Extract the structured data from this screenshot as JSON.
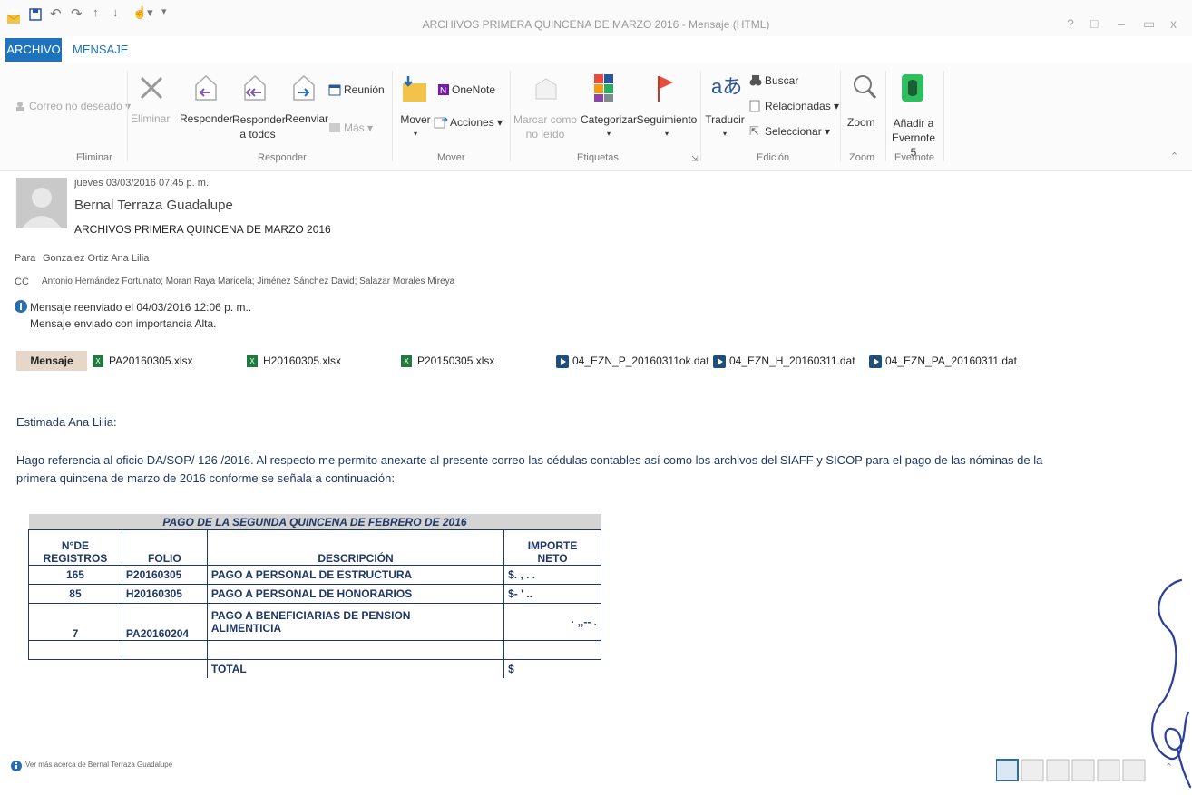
{
  "titlebar": {
    "title": "ARCHIVOS PRIMERA QUINCENA DE MARZO 2016 - Mensaje (HTML)",
    "controls": [
      "?",
      "□",
      "–",
      "▭",
      "x"
    ]
  },
  "tabs": {
    "archivo": "ARCHIVO",
    "mensaje": "MENSAJE"
  },
  "ribbon": {
    "correo_no_deseado": "Correo no deseado",
    "eliminar": "Eliminar",
    "responder": "Responder",
    "responder_todos_1": "Responder",
    "responder_todos_2": "a todos",
    "reenviar": "Reenviar",
    "reunion": "Reunión",
    "mas": "Más",
    "mover": "Mover",
    "onenote": "OneNote",
    "acciones": "Acciones",
    "marcar_1": "Marcar como",
    "marcar_2": "no leído",
    "categorizar": "Categorizar",
    "seguimiento": "Seguimiento",
    "traducir": "Traducir",
    "buscar": "Buscar",
    "relacionadas": "Relacionadas",
    "seleccionar": "Seleccionar",
    "zoom": "Zoom",
    "evernote_1": "Añadir a",
    "evernote_2": "Evernote 5",
    "groups": {
      "eliminar": "Eliminar",
      "responder": "Responder",
      "mover": "Mover",
      "etiquetas": "Etiquetas",
      "edicion": "Edición",
      "zoom": "Zoom",
      "evernote": "Evernote"
    }
  },
  "header": {
    "date": "jueves 03/03/2016 07:45 p. m.",
    "sender": "Bernal Terraza Guadalupe",
    "subject": "ARCHIVOS PRIMERA QUINCENA DE MARZO 2016",
    "to_label": "Para",
    "to": "Gonzalez Ortiz Ana Lilia",
    "cc_label": "CC",
    "cc": "Antonio Hernández Fortunato; Moran Raya Maricela; Jiménez Sánchez David; Salazar Morales Mireya",
    "info_1": "Mensaje reenviado el 04/03/2016 12:06 p. m..",
    "info_2": "Mensaje enviado con importancia Alta."
  },
  "attachments": {
    "mensaje": "Mensaje",
    "files": [
      "PA20160305.xlsx",
      "H20160305.xlsx",
      "P20150305.xlsx",
      "04_EZN_P_20160311ok.dat",
      "04_EZN_H_20160311.dat",
      "04_EZN_PA_20160311.dat"
    ]
  },
  "body": {
    "greeting": "Estimada Ana Lilia:",
    "para_line1": "Hago referencia al oficio DA/SOP/ 126 /2016. Al respecto me permito anexarte al presente correo las cédulas contables así como los archivos del SIAFF y SICOP para el pago de las nóminas de la",
    "para_line2": "primera quincena de marzo de 2016 conforme se señala a continuación:"
  },
  "table": {
    "caption": "PAGO DE LA SEGUNDA QUINCENA DE FEBRERO DE 2016",
    "h_registros_1": "N°DE",
    "h_registros_2": "REGISTROS",
    "h_folio": "FOLIO",
    "h_descripcion": "DESCRIPCIÓN",
    "h_importe_1": "IMPORTE",
    "h_importe_2": "NETO",
    "rows": [
      {
        "registros": "165",
        "folio": "P20160305",
        "descripcion": "PAGO A PERSONAL DE ESTRUCTURA",
        "importe": "$.   ,  .  ."
      },
      {
        "registros": "85",
        "folio": "H20160305",
        "descripcion": "PAGO A PERSONAL DE HONORARIOS",
        "importe": "$-   ' .."
      },
      {
        "registros": "7",
        "folio": "PA20160204",
        "descripcion_1": "PAGO A BENEFICIARIAS DE PENSION",
        "descripcion_2": "ALIMENTICIA",
        "importe": "· ,,-- ."
      }
    ],
    "total_label": "TOTAL",
    "total_value": "$"
  },
  "footer": {
    "text": "Ver más acerca de Bernal Terraza Guadalupe"
  }
}
